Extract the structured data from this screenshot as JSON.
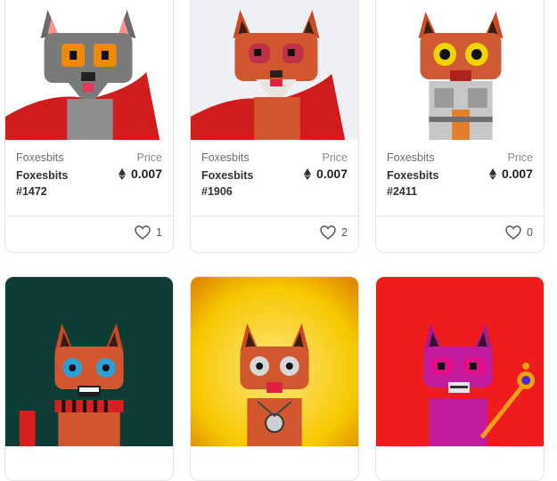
{
  "items": [
    {
      "collection": "Foxesbits",
      "name": "Foxesbits #1472",
      "price_label": "Price",
      "price": "0.007",
      "likes": "1",
      "image": "nft-art-gray-fox-orange-eyes-red-cape",
      "bg": "#ffffff",
      "fur": "#7a7a7a",
      "eye": "#f08a00",
      "outfit": "red-cape"
    },
    {
      "collection": "Foxesbits",
      "name": "Foxesbits #1906",
      "price_label": "Price",
      "price": "0.007",
      "likes": "2",
      "image": "nft-art-orange-fox-red-cape-white-texture",
      "bg": "#eef0f4",
      "fur": "#d3572e",
      "eye": "#c03048",
      "outfit": "red-cape"
    },
    {
      "collection": "Foxesbits",
      "name": "Foxesbits #2411",
      "price_label": "Price",
      "price": "0.007",
      "likes": "0",
      "image": "nft-art-orange-fox-armor",
      "bg": "#ffffff",
      "fur": "#cf5a33",
      "eye": "#f3d400",
      "outfit": "armor"
    },
    {
      "image": "nft-art-orange-fox-blue-eyes-striped-scarf",
      "bg": "#0e3b34",
      "fur": "#d3572e",
      "eye": "#2a9fd8",
      "outfit": "scarf"
    },
    {
      "image": "nft-art-orange-fox-gray-eyes-medallion",
      "bg": "#f4c000",
      "fur": "#d3572e",
      "eye": "#d6d6d6",
      "outfit": "medallion"
    },
    {
      "image": "nft-art-pink-fox-golden-scepter",
      "bg": "#ee1c1c",
      "fur": "#c21c9e",
      "eye": "#e0108a",
      "outfit": "scepter"
    }
  ],
  "colors": {
    "card_border": "#e4e4e4",
    "text_dark": "#333333",
    "text_muted": "#6d6d6d"
  },
  "icons": {
    "currency": "ethereum-icon",
    "like": "heart-icon"
  }
}
